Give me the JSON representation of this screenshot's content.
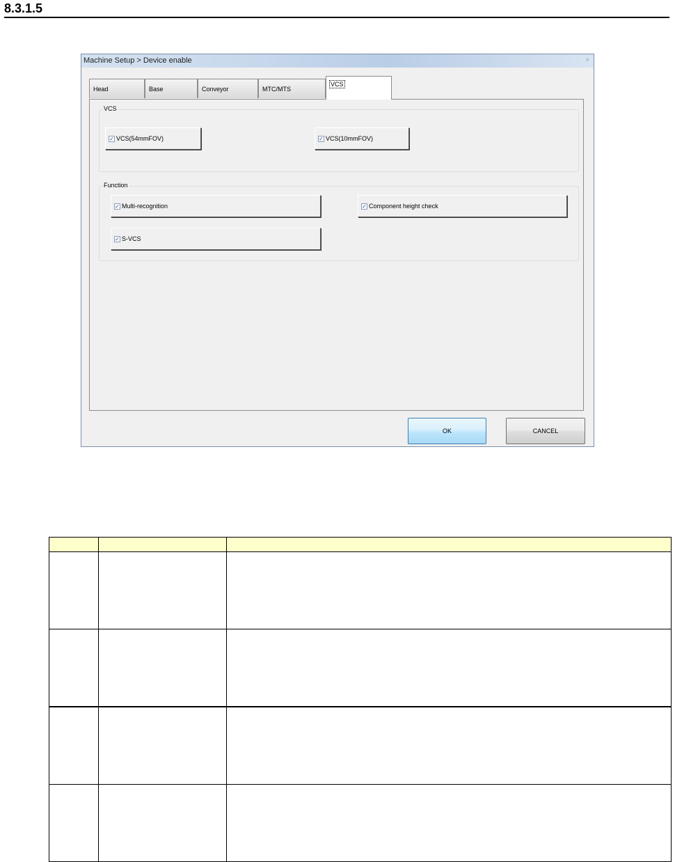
{
  "section": {
    "number": "8.3.1.5"
  },
  "dialog": {
    "title": "Machine Setup > Device enable",
    "close_glyph": "×",
    "tabs": [
      {
        "label": "Head",
        "active": false
      },
      {
        "label": "Base",
        "active": false
      },
      {
        "label": "Conveyor",
        "active": false
      },
      {
        "label": "MTC/MTS",
        "active": false
      },
      {
        "label": "VCS",
        "active": true
      }
    ],
    "groups": {
      "vcs": {
        "label": "VCS",
        "items": [
          {
            "label": "VCS(54mmFOV)",
            "checked": true
          },
          {
            "label": "VCS(10mmFOV)",
            "checked": true
          }
        ]
      },
      "function": {
        "label": "Function",
        "items": [
          {
            "label": "Multi-recognition",
            "checked": true
          },
          {
            "label": "Component height check",
            "checked": true
          },
          {
            "label": "S-VCS",
            "checked": true
          }
        ]
      }
    },
    "buttons": {
      "ok": "OK",
      "cancel": "CANCEL"
    },
    "checkmark": "✓"
  },
  "table": {
    "headers": [
      "",
      "",
      ""
    ],
    "row_count": 4
  }
}
